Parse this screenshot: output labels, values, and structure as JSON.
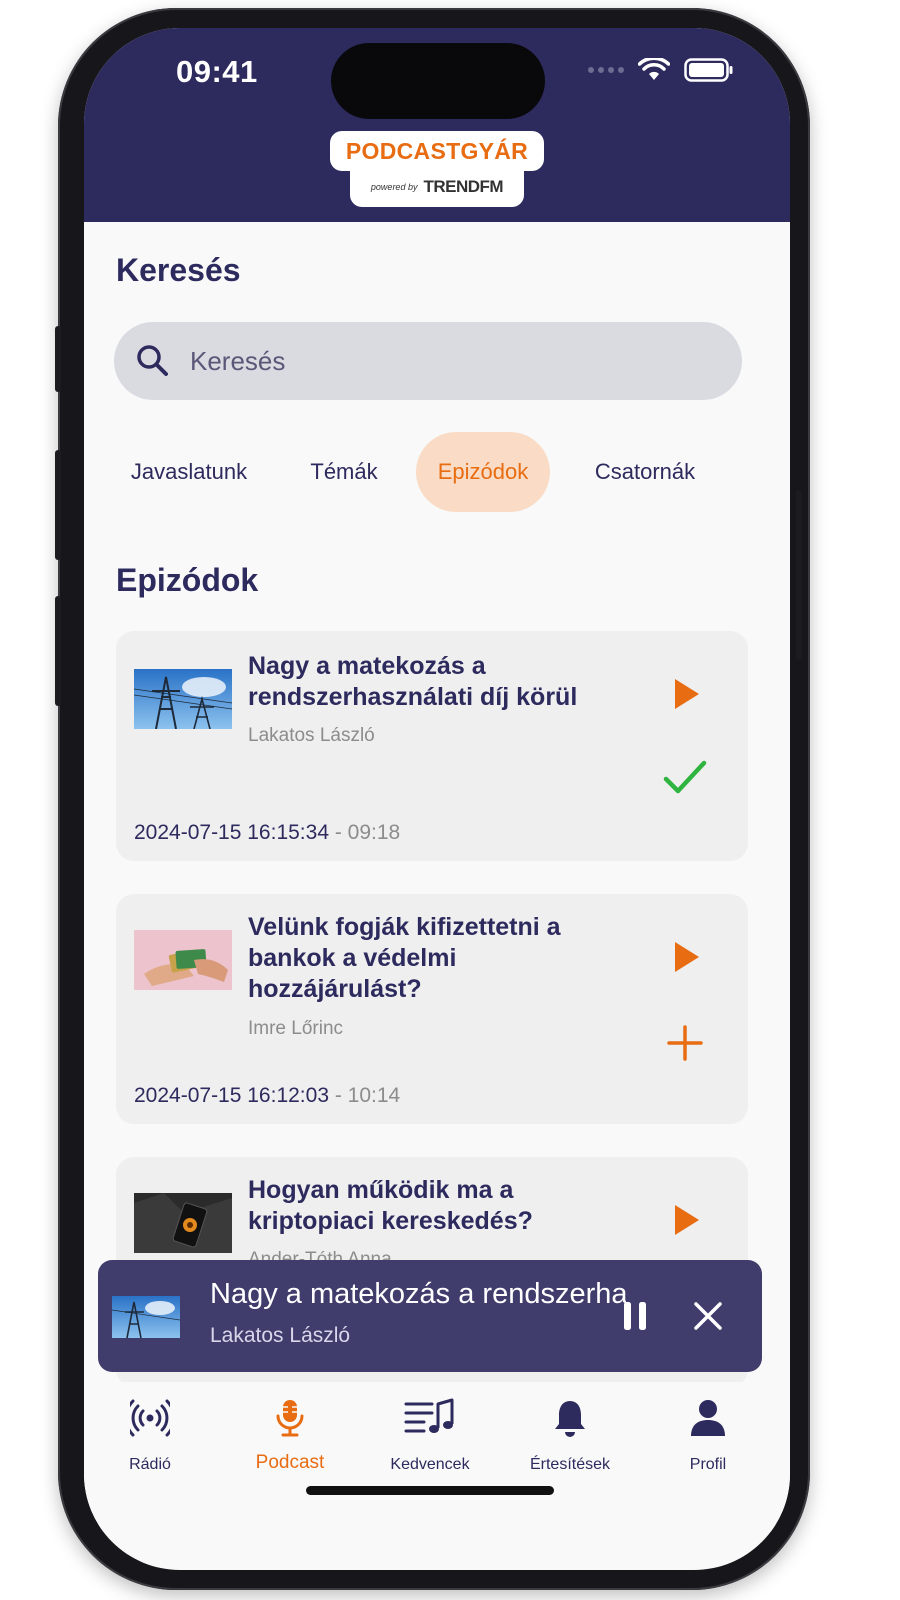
{
  "status_bar": {
    "time": "09:41"
  },
  "brand": {
    "logo_top": "PODCASTGYÁR",
    "powered_by": "powered by",
    "partner_logo": "TRENDFM"
  },
  "search": {
    "title": "Keresés",
    "placeholder": "Keresés"
  },
  "tabs": [
    {
      "label": "Javaslatunk",
      "active": false
    },
    {
      "label": "Témák",
      "active": false
    },
    {
      "label": "Epizódok",
      "active": true
    },
    {
      "label": "Csatornák",
      "active": false
    }
  ],
  "episodes": {
    "title": "Epizódok",
    "items": [
      {
        "title": "Nagy a matekozás a rendszerhasználati díj körül",
        "author": "Lakatos László",
        "date": "2024-07-15 16:15:34",
        "separator": " - ",
        "duration": "09:18",
        "status_icon": "check-icon"
      },
      {
        "title": "Velünk fogják kifizettetni a bankok a védelmi hozzájárulást?",
        "author": "Imre Lőrinc",
        "date": "2024-07-15 16:12:03",
        "separator": " - ",
        "duration": "10:14",
        "status_icon": "plus-icon"
      },
      {
        "title": "Hogyan működik ma a kriptopiaci kereskedés?",
        "author": "Ander-Tóth Anna",
        "date": "",
        "separator": "",
        "duration": "",
        "status_icon": ""
      }
    ]
  },
  "now_playing": {
    "title": "Nagy a matekozás a rendszerhasználati díj körül",
    "author": "Lakatos László",
    "state": "playing"
  },
  "bottom_nav": [
    {
      "label": "Rádió",
      "icon": "radio-broadcast-icon",
      "active": false
    },
    {
      "label": "Podcast",
      "icon": "microphone-icon",
      "active": true
    },
    {
      "label": "Kedvencek",
      "icon": "playlist-music-icon",
      "active": false
    },
    {
      "label": "Értesítések",
      "icon": "bell-icon",
      "active": false
    },
    {
      "label": "Profil",
      "icon": "user-icon",
      "active": false
    }
  ],
  "colors": {
    "primary": "#2d2a5e",
    "accent": "#e86c12",
    "accent_soft": "#fadcc6",
    "success": "#2fb53f",
    "player_bg": "#403d6c"
  }
}
